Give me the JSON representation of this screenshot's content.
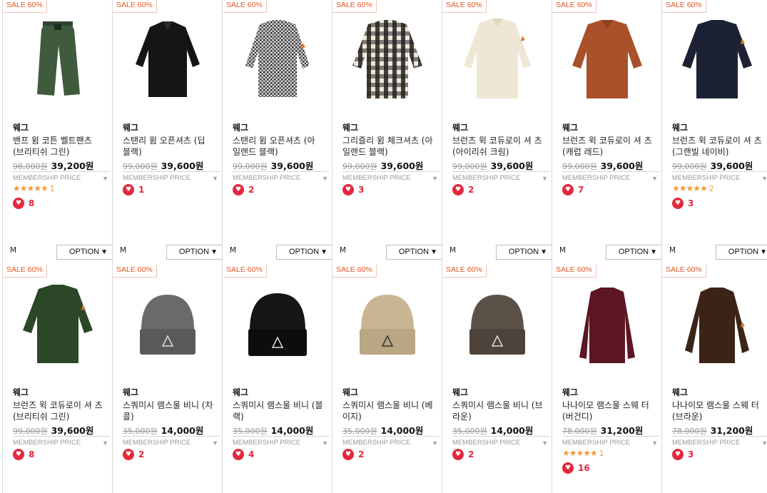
{
  "rows": [
    [
      {
        "badge": "SALE 60%",
        "product": "green-pants",
        "brand": "웨그",
        "name": "밴프 윔 코튼 벨트팬츠 (브리티쉬 그린)",
        "orig": "98,000원",
        "price": "39,200원",
        "member": "MEMBERSHIP PRICE",
        "stars": "★★★★★",
        "star_count": "1",
        "likes": "8",
        "size": "M",
        "option": "OPTION"
      },
      {
        "badge": "SALE 60%",
        "product": "black-shirt",
        "brand": "웨그",
        "name": "스탠리 윔 오픈셔츠 (딥 블랙)",
        "orig": "99,000원",
        "price": "39,600원",
        "member": "MEMBERSHIP PRICE",
        "stars": "",
        "star_count": "",
        "likes": "1",
        "size": "M",
        "option": "OPTION"
      },
      {
        "badge": "SALE 60%",
        "product": "houndstooth-shirt",
        "brand": "웨그",
        "name": "스탠리 윔 오픈셔츠 (아 일랜드 블랙)",
        "orig": "99,000원",
        "price": "39,600원",
        "member": "MEMBERSHIP PRICE",
        "stars": "",
        "star_count": "",
        "likes": "2",
        "size": "M",
        "option": "OPTION"
      },
      {
        "badge": "SALE 60%",
        "product": "check-shirt",
        "brand": "웨그",
        "name": "그리즐리 윔 체크셔츠 (아일랜드 블랙)",
        "orig": "99,000원",
        "price": "39,600원",
        "member": "MEMBERSHIP PRICE",
        "stars": "",
        "star_count": "",
        "likes": "3",
        "size": "M",
        "option": "OPTION"
      },
      {
        "badge": "SALE 60%",
        "product": "cream-shirt",
        "brand": "웨그",
        "name": "브런즈 윅 코듀로이 셔 츠 (아이리쉬 크림)",
        "orig": "99,000원",
        "price": "39,600원",
        "member": "MEMBERSHIP PRICE",
        "stars": "",
        "star_count": "",
        "likes": "2",
        "size": "M",
        "option": "OPTION"
      },
      {
        "badge": "SALE 60%",
        "product": "rust-shirt",
        "brand": "웨그",
        "name": "브런즈 윅 코듀로이 셔 츠 (캐럽 레드)",
        "orig": "99,000원",
        "price": "39,600원",
        "member": "MEMBERSHIP PRICE",
        "stars": "",
        "star_count": "",
        "likes": "7",
        "size": "M",
        "option": "OPTION"
      },
      {
        "badge": "SALE 60%",
        "product": "navy-shirt",
        "brand": "웨그",
        "name": "브런즈 윅 코듀로이 셔 츠 (그랜빌 네이비)",
        "orig": "99,000원",
        "price": "39,600원",
        "member": "MEMBERSHIP PRICE",
        "stars": "★★★★★",
        "star_count": "2",
        "likes": "3",
        "size": "M",
        "option": "OPTION"
      }
    ],
    [
      {
        "badge": "SALE 60%",
        "product": "green-shirt",
        "brand": "웨그",
        "name": "브런즈 윅 코듀로이 셔 츠 (브리티쉬 그린)",
        "orig": "99,000원",
        "price": "39,600원",
        "member": "MEMBERSHIP PRICE",
        "stars": "",
        "star_count": "",
        "likes": "8"
      },
      {
        "badge": "SALE 60%",
        "product": "charcoal-beanie",
        "brand": "웨그",
        "name": "스쿼미시 램스울 비니 (차콜)",
        "orig": "35,000원",
        "price": "14,000원",
        "member": "MEMBERSHIP PRICE",
        "stars": "",
        "star_count": "",
        "likes": "2"
      },
      {
        "badge": "SALE 60%",
        "product": "black-beanie",
        "brand": "웨그",
        "name": "스쿼미시 램스울 비니 (블랙)",
        "orig": "35,000원",
        "price": "14,000원",
        "member": "MEMBERSHIP PRICE",
        "stars": "",
        "star_count": "",
        "likes": "4"
      },
      {
        "badge": "SALE 60%",
        "product": "beige-beanie",
        "brand": "웨그",
        "name": "스쿼미시 램스울 비니 (베이지)",
        "orig": "35,000원",
        "price": "14,000원",
        "member": "MEMBERSHIP PRICE",
        "stars": "",
        "star_count": "",
        "likes": "2"
      },
      {
        "badge": "SALE 60%",
        "product": "brown-beanie",
        "brand": "웨그",
        "name": "스쿼미시 램스울 비니 (브라운)",
        "orig": "35,000원",
        "price": "14,000원",
        "member": "MEMBERSHIP PRICE",
        "stars": "",
        "star_count": "",
        "likes": "2"
      },
      {
        "badge": "SALE 60%",
        "product": "burgundy-sweater",
        "brand": "웨그",
        "name": "나나이모 램스울 스웨 터 (버건디)",
        "orig": "78,000원",
        "price": "31,200원",
        "member": "MEMBERSHIP PRICE",
        "stars": "★★★★★",
        "star_count": "1",
        "likes": "16"
      },
      {
        "badge": "SALE 60%",
        "product": "brown-sweater",
        "brand": "웨그",
        "name": "나나이모 램스울 스웨 터 (브라운)",
        "orig": "78,000원",
        "price": "31,200원",
        "member": "MEMBERSHIP PRICE",
        "stars": "",
        "star_count": "",
        "likes": "3"
      }
    ]
  ],
  "colors": {
    "sale": "#e8541e",
    "heart": "#e4283d",
    "star": "#f39a3b"
  }
}
